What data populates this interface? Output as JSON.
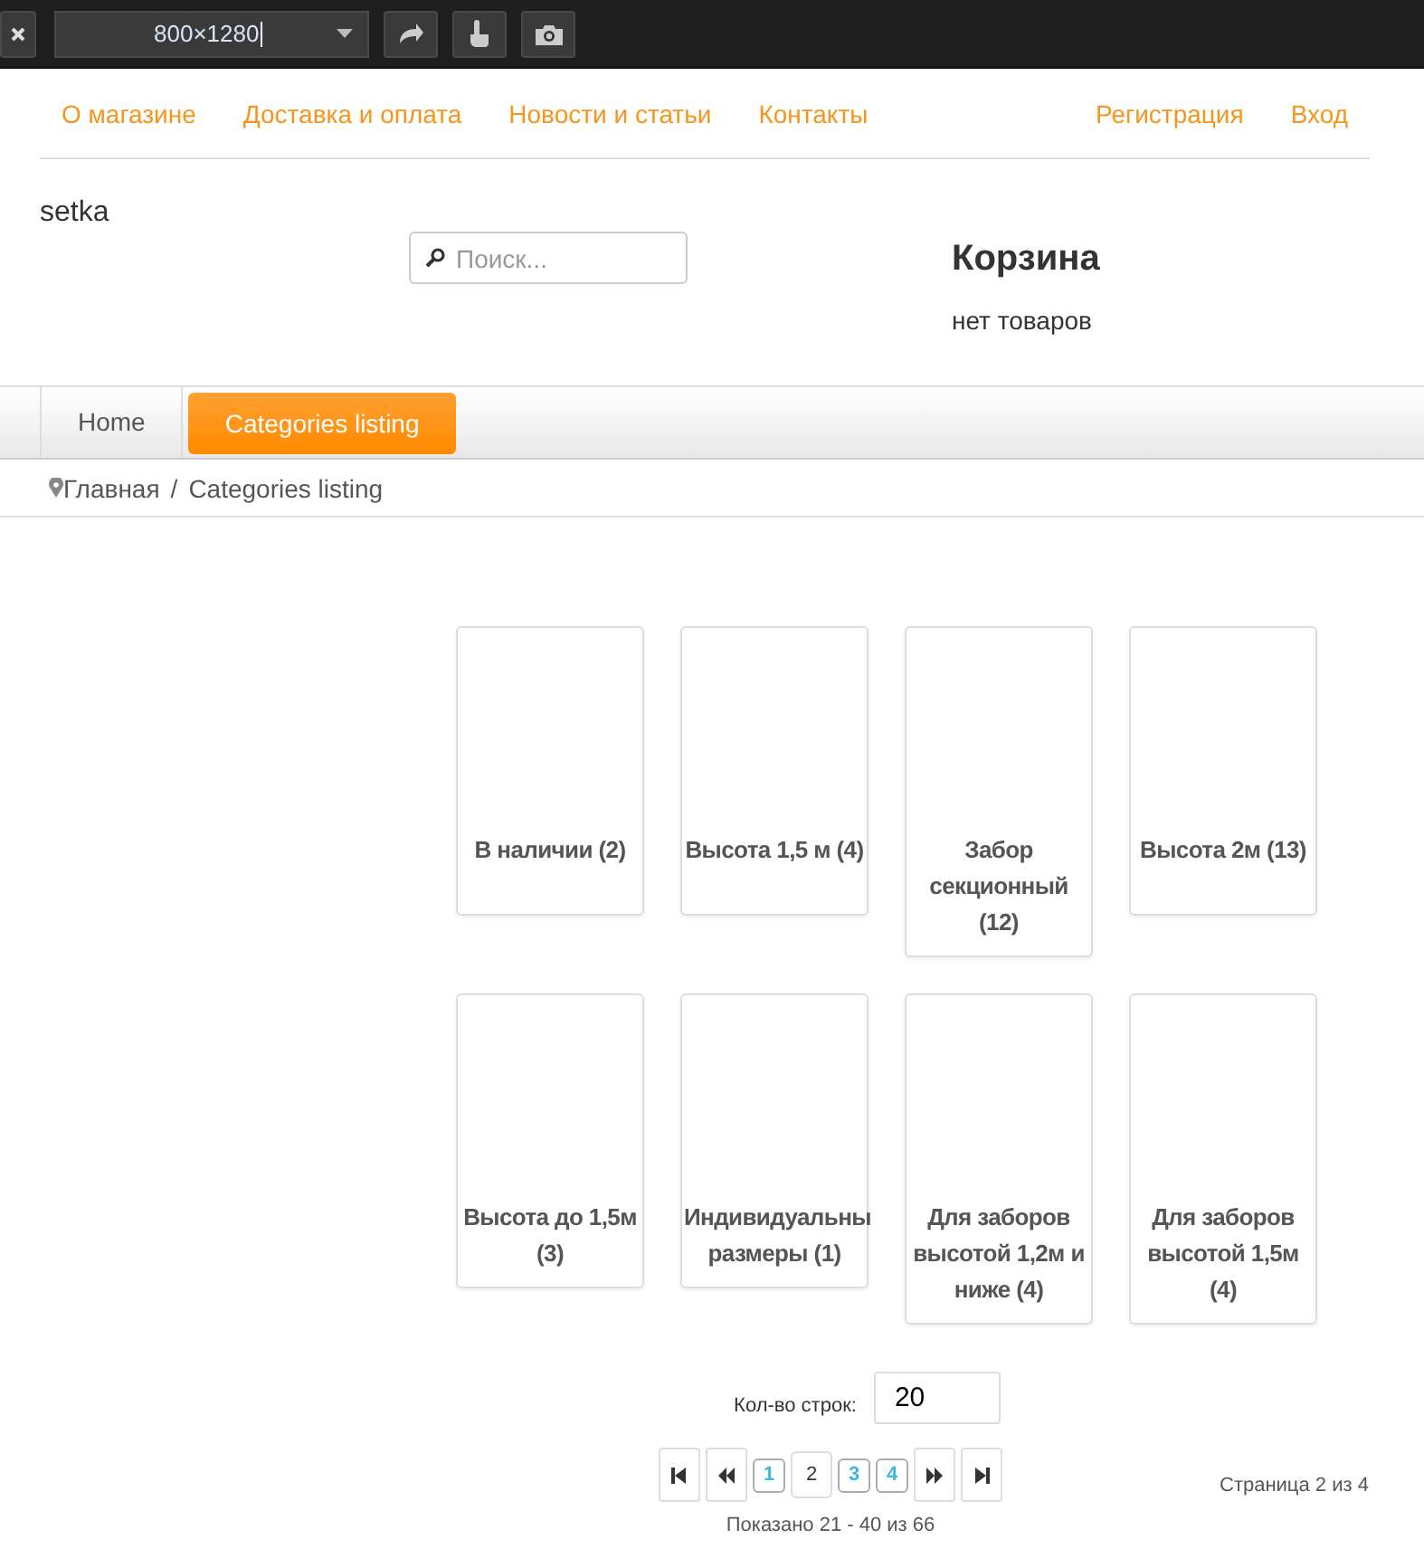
{
  "toolbar": {
    "size_value": "800×1280"
  },
  "top_links_left": [
    {
      "label": "О магазине"
    },
    {
      "label": "Доставка и оплата"
    },
    {
      "label": "Новости и статьи"
    },
    {
      "label": "Контакты"
    }
  ],
  "top_links_right": [
    {
      "label": "Регистрация"
    },
    {
      "label": "Вход"
    }
  ],
  "header": {
    "logo": "setka",
    "search": {
      "placeholder": "Поиск..."
    },
    "cart": {
      "title": "Корзина",
      "status": "нет товаров"
    }
  },
  "nav_tabs": [
    {
      "label": "Home",
      "selected": false
    },
    {
      "label": "Categories listing",
      "selected": true
    }
  ],
  "breadcrumb": [
    {
      "label": "Главная"
    },
    {
      "label": "/"
    },
    {
      "label": "Categories listing"
    }
  ],
  "categories": [
    {
      "name": "В наличии (2)"
    },
    {
      "name": "Высота 1,5 м (4)"
    },
    {
      "name": "Забор секционный (12)"
    },
    {
      "name": "Высота 2м (13)"
    },
    {
      "name": "Высота до 1,5м (3)"
    },
    {
      "name": "Индивидуальны размеры (1)"
    },
    {
      "name": "Для заборов высотой 1,2м и ниже (4)"
    },
    {
      "name": "Для заборов высотой 1,5м (4)"
    }
  ],
  "rows_per_page": {
    "label": "Кол-во строк:",
    "value": "20"
  },
  "pagination": {
    "pages": [
      {
        "label": "1",
        "selected": false
      },
      {
        "label": "2",
        "selected": true
      },
      {
        "label": "3",
        "selected": false
      },
      {
        "label": "4",
        "selected": false
      }
    ],
    "page_info": "Страница 2 из 4",
    "shown": "Показано 21 - 40 из 66"
  }
}
